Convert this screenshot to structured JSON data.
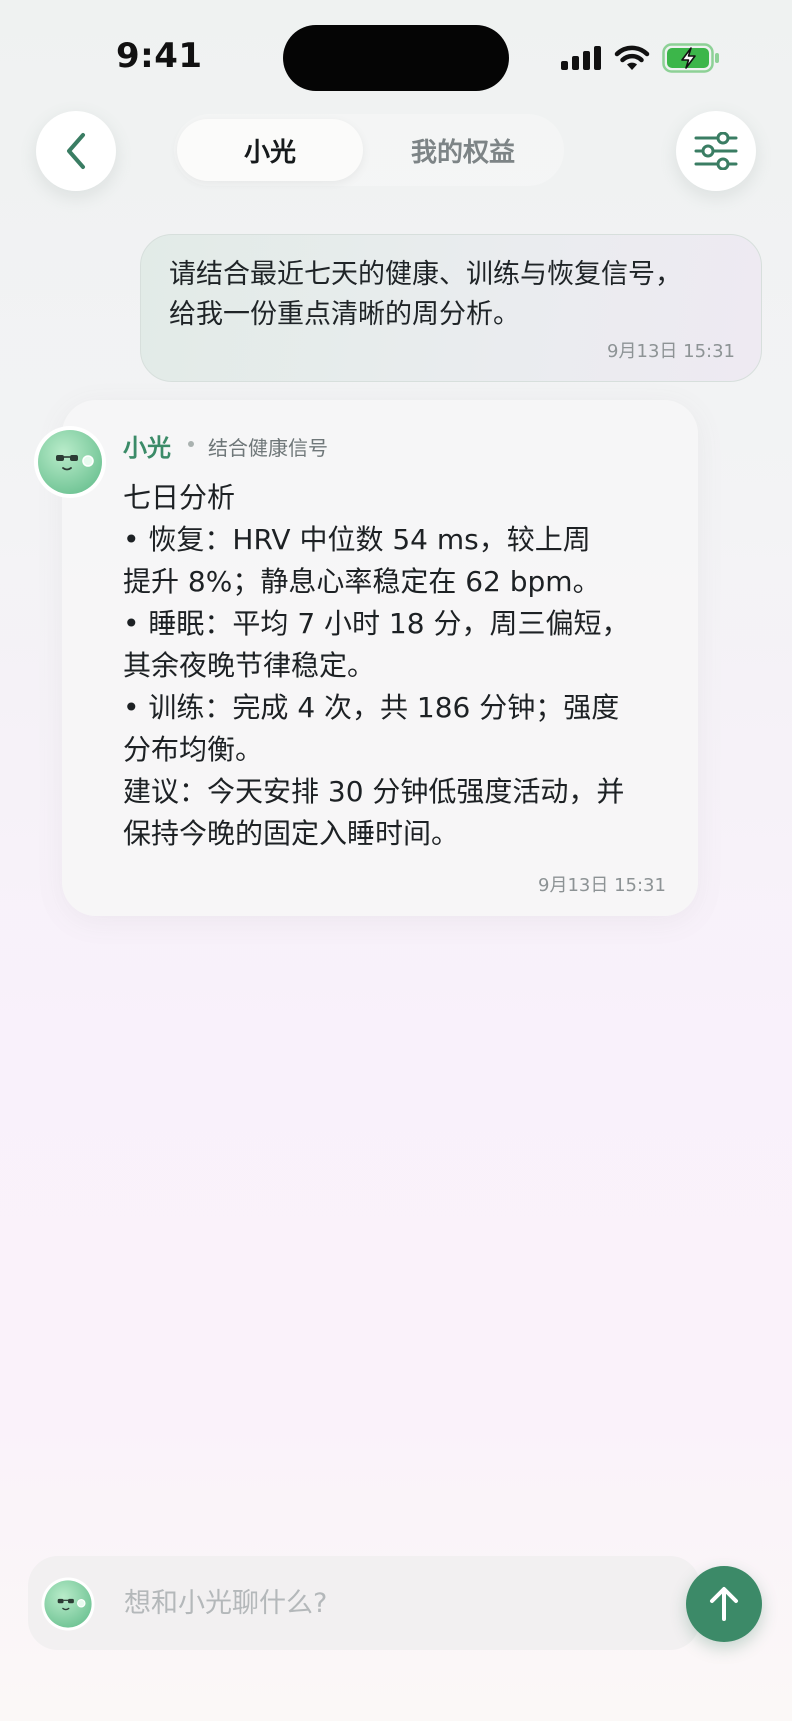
{
  "status_bar": {
    "time": "9:41"
  },
  "header": {
    "back_icon": "chevron-left-icon",
    "settings_icon": "sliders-icon",
    "tabs": [
      {
        "label": "小光",
        "active": true
      },
      {
        "label": "我的权益",
        "active": false
      }
    ]
  },
  "messages": {
    "user": {
      "text": "请结合最近七天的健康、训练与恢复信号，\n给我一份重点清晰的周分析。",
      "time": "9月13日 15:31"
    },
    "bot": {
      "name": "小光",
      "tag": "结合健康信号",
      "lines": [
        "七日分析",
        "• 恢复：HRV 中位数 54 ms，较上周",
        "提升 8%；静息心率稳定在 62 bpm。",
        "• 睡眠：平均 7 小时 18 分，周三偏短，",
        "其余夜晚节律稳定。",
        "• 训练：完成 4 次，共 186 分钟；强度",
        "分布均衡。",
        "建议：今天安排 30 分钟低强度活动，并",
        "保持今晚的固定入睡时间。"
      ],
      "time": "9月13日 15:31"
    }
  },
  "composer": {
    "placeholder": "想和小光聊什么?",
    "value": "",
    "send_icon": "arrow-up-icon"
  },
  "colors": {
    "accent": "#3c8a68",
    "bot_name": "#3b8b68",
    "avatar_green": "#8fd4ad"
  }
}
